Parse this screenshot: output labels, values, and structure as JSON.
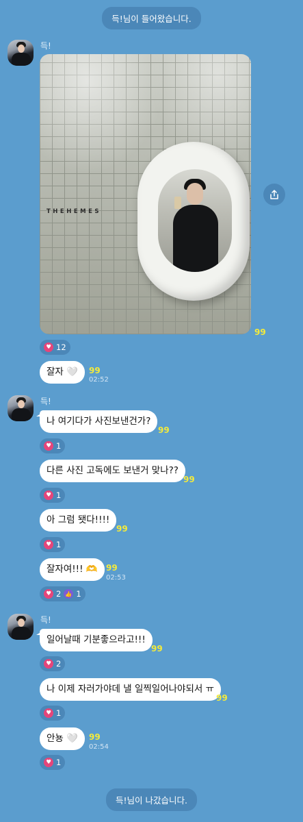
{
  "system": {
    "joined": "득!님이 들어왔습니다.",
    "left": "득!님이 나갔습니다."
  },
  "sender_name": "득!",
  "photo": {
    "brand_text": "THEHEMES",
    "unread": "99",
    "reaction_count": "12"
  },
  "groups": [
    {
      "name": "득!"
    },
    {
      "name": "득!"
    },
    {
      "name": "득!"
    }
  ],
  "messages": [
    {
      "text": "잘자 🤍",
      "unread": "99",
      "time": "02:52",
      "heart": ""
    },
    {
      "text": "나 여기다가 사진보낸건가?",
      "unread": "99",
      "heart": "1"
    },
    {
      "text": "다른 사진 고독에도 보낸거 맞나??",
      "unread": "99",
      "heart": "1"
    },
    {
      "text": "아 그럼 됏다!!!!",
      "unread": "99",
      "heart": "1"
    },
    {
      "text": "잘자여!!! 🫶",
      "unread": "99",
      "time": "02:53",
      "heart": "2",
      "thumb": "1"
    },
    {
      "text": "일어날때 기분좋으라고!!!",
      "unread": "99",
      "heart": "2"
    },
    {
      "text": "나 이제 자러가야데 낼 일찍일어나야되서 ㅠ",
      "unread": "99",
      "heart": "1"
    },
    {
      "text": "안뇽 🤍",
      "unread": "99",
      "time": "02:54",
      "heart": "1"
    }
  ],
  "icons": {
    "heart": "heart-icon",
    "thumb": "thumbs-up-icon",
    "share": "share-icon",
    "avatar": "profile-avatar"
  },
  "colors": {
    "background": "#5b9dce",
    "unread": "#f3ea3c",
    "heart": "#e5457a",
    "thumb": "#7c5bd6"
  }
}
